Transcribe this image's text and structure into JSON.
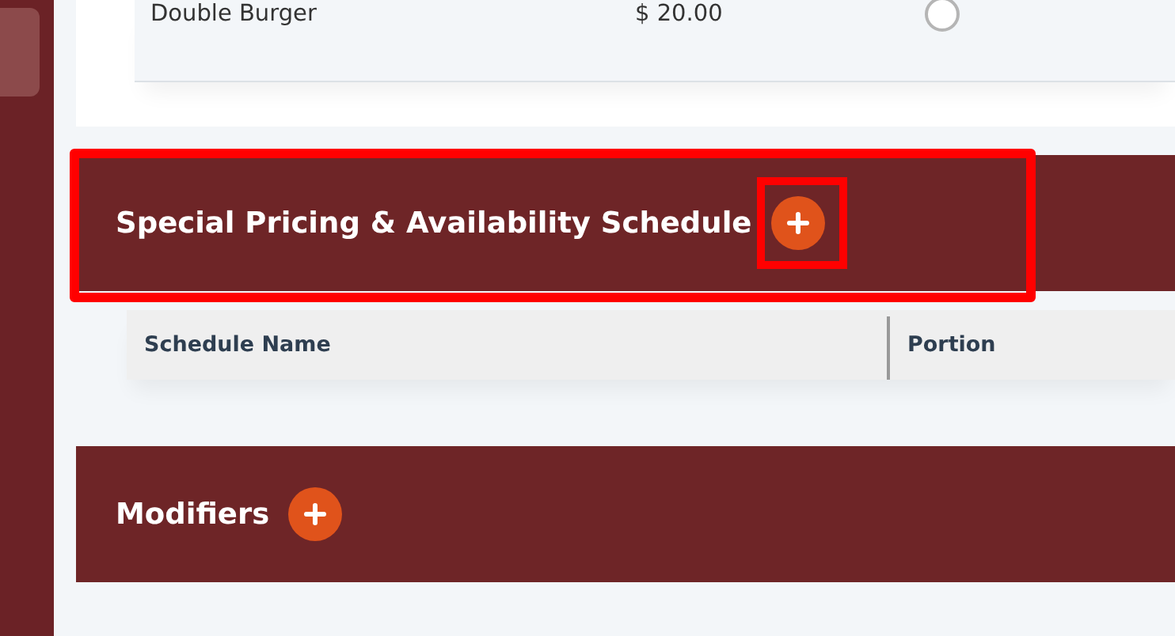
{
  "menu_items": [
    {
      "name": "Double Burger",
      "price": "$ 20.00",
      "selected": false
    }
  ],
  "sections": [
    {
      "title": "Special Pricing & Availability Schedule",
      "highlighted": true,
      "add_button_highlighted": true,
      "table": {
        "columns": [
          "Schedule Name",
          "Portion"
        ]
      }
    },
    {
      "title": "Modifiers",
      "highlighted": false,
      "add_button_highlighted": false
    }
  ]
}
